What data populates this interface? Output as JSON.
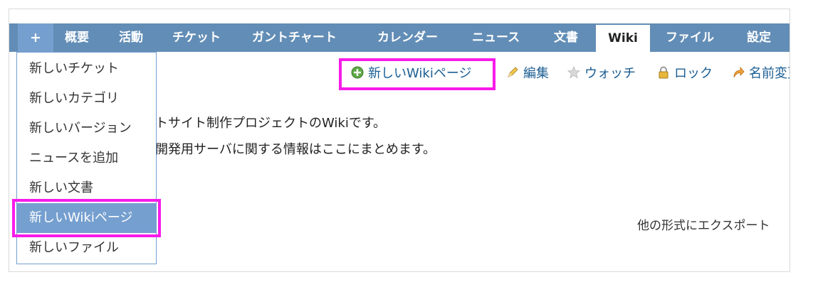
{
  "tabs": [
    {
      "label": "+"
    },
    {
      "label": "概要"
    },
    {
      "label": "活動"
    },
    {
      "label": "チケット"
    },
    {
      "label": "ガントチャート"
    },
    {
      "label": "カレンダー"
    },
    {
      "label": "ニュース"
    },
    {
      "label": "文書"
    },
    {
      "label": "Wiki",
      "selected": true
    },
    {
      "label": "ファイル"
    },
    {
      "label": "設定"
    }
  ],
  "dropdown": {
    "items": [
      {
        "label": "新しいチケット"
      },
      {
        "label": "新しいカテゴリ"
      },
      {
        "label": "新しいバージョン"
      },
      {
        "label": "ニュースを追加"
      },
      {
        "label": "新しい文書"
      },
      {
        "label": "新しいWikiページ",
        "hovered": true
      },
      {
        "label": "新しいファイル"
      }
    ]
  },
  "contextual": {
    "new_wiki_page": "新しいWikiページ",
    "edit": "編集",
    "watch": "ウォッチ",
    "lock": "ロック",
    "rename": "名前変更"
  },
  "content": {
    "line1": "トサイト制作プロジェクトのWikiです。",
    "line2": "開発用サーバに関する情報はここにまとめます。",
    "export_label": "他の形式にエクスポート"
  },
  "colors": {
    "tab_bar": "#628db6",
    "accent": "#759fcf",
    "highlight": "#f81bea"
  }
}
